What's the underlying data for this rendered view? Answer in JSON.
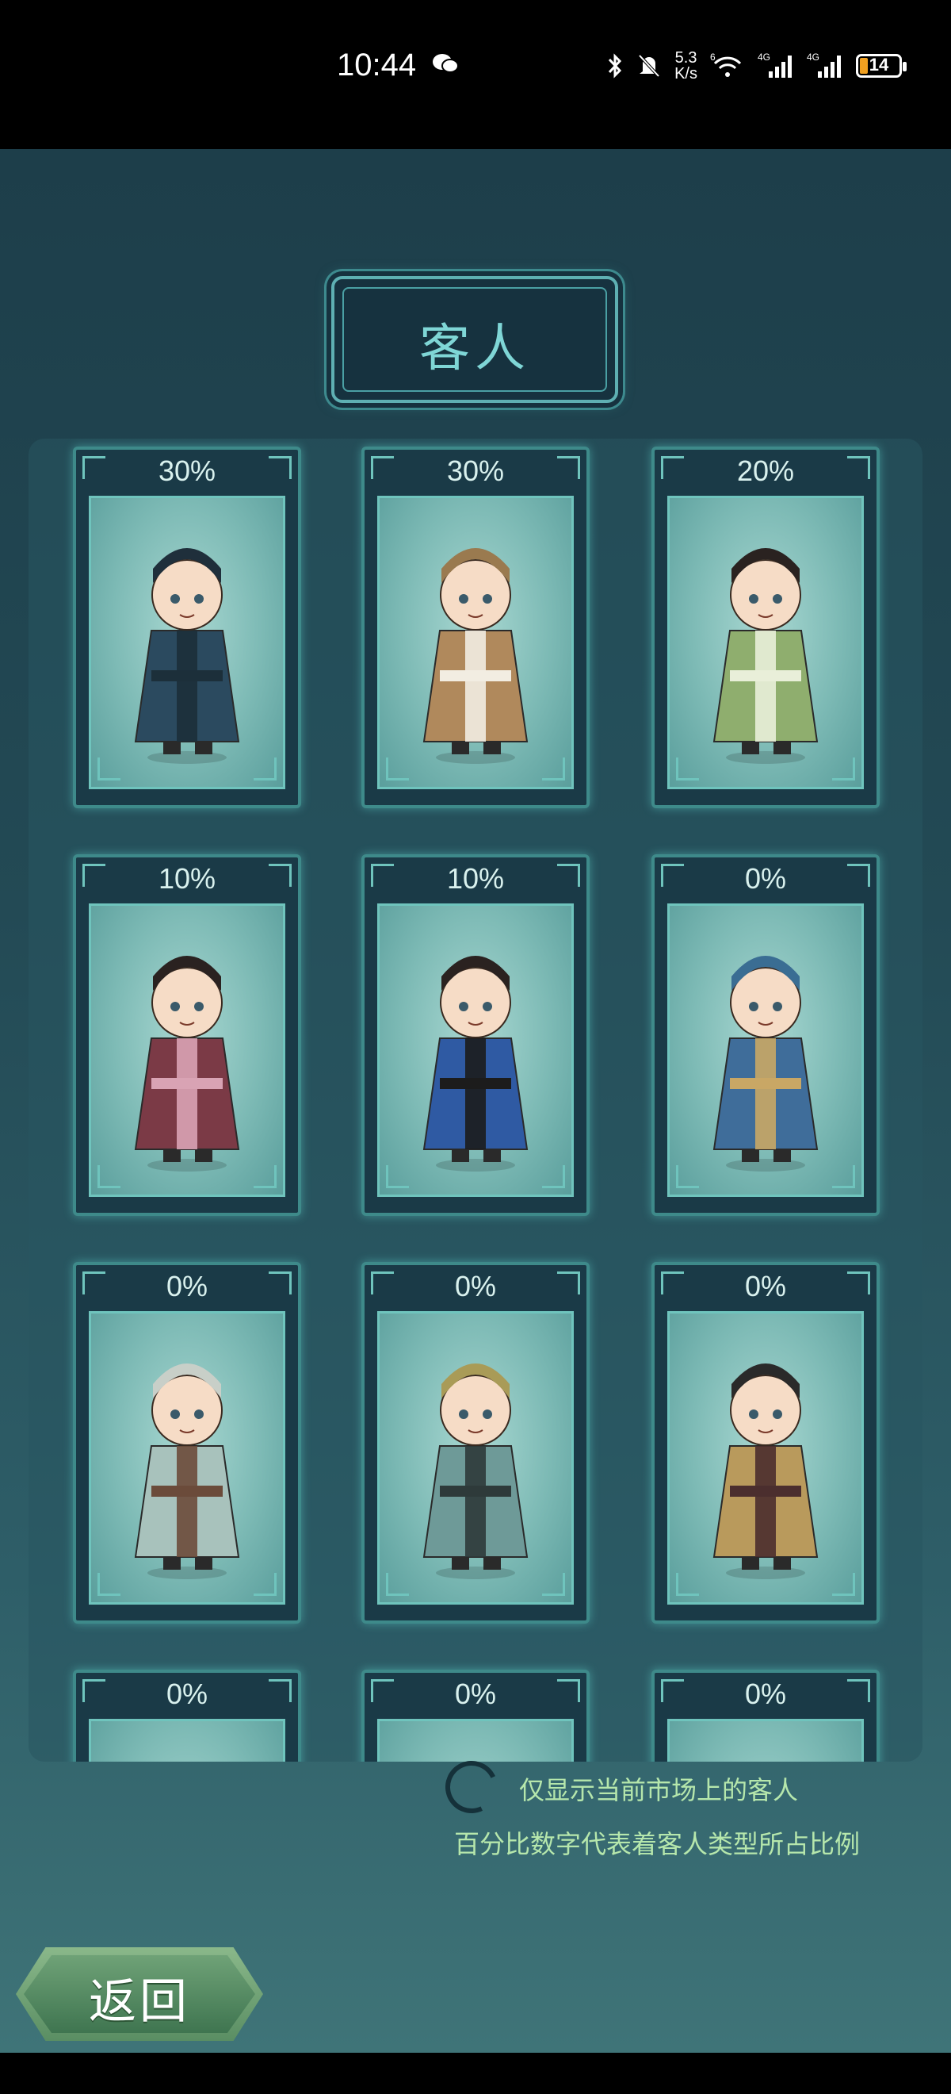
{
  "status_bar": {
    "time": "10:44",
    "net_speed_value": "5.3",
    "net_speed_unit": "K/s",
    "signal_labels": [
      "6",
      "4G",
      "4G"
    ],
    "battery": "14",
    "icons": [
      "wechat-icon",
      "bluetooth-icon",
      "mute-bell-icon",
      "wifi-icon",
      "signal-icon",
      "signal-icon",
      "battery-icon"
    ]
  },
  "title": "客人",
  "guests": [
    {
      "percent": "30%",
      "costume": "#2b4a5f",
      "accent": "#1c2f3a",
      "hat": "#1f2f3b"
    },
    {
      "percent": "30%",
      "costume": "#b0895c",
      "accent": "#f2ede2",
      "hat": "#9a7a4f"
    },
    {
      "percent": "20%",
      "costume": "#8fae6e",
      "accent": "#e9efd9",
      "hat": "#2a2220"
    },
    {
      "percent": "10%",
      "costume": "#7b3a46",
      "accent": "#d9a3b4",
      "hat": "#2a2220"
    },
    {
      "percent": "10%",
      "costume": "#2f5aa3",
      "accent": "#1c1c1c",
      "hat": "#2a2220"
    },
    {
      "percent": "0%",
      "costume": "#3f6d9a",
      "accent": "#c9a765",
      "hat": "#3a6d93"
    },
    {
      "percent": "0%",
      "costume": "#a8c2bc",
      "accent": "#6b4b3a",
      "hat": "#c8cfc8"
    },
    {
      "percent": "0%",
      "costume": "#6e9a98",
      "accent": "#2e3a3a",
      "hat": "#a99b57"
    },
    {
      "percent": "0%",
      "costume": "#b99a5c",
      "accent": "#4b2e2e",
      "hat": "#2a2a2a"
    },
    {
      "percent": "0%",
      "costume": "#6e9a98",
      "accent": "#2e3a3a",
      "hat": "#b99a5c"
    },
    {
      "percent": "0%",
      "costume": "#6e9a98",
      "accent": "#2e3a3a",
      "hat": "#b99a5c"
    },
    {
      "percent": "0%",
      "costume": "#6e9a98",
      "accent": "#2e3a3a",
      "hat": "#2a2a2a"
    }
  ],
  "notes": {
    "toggle_label": "仅显示当前市场上的客人",
    "explanation": "百分比数字代表着客人类型所占比例"
  },
  "back_button": "返回"
}
